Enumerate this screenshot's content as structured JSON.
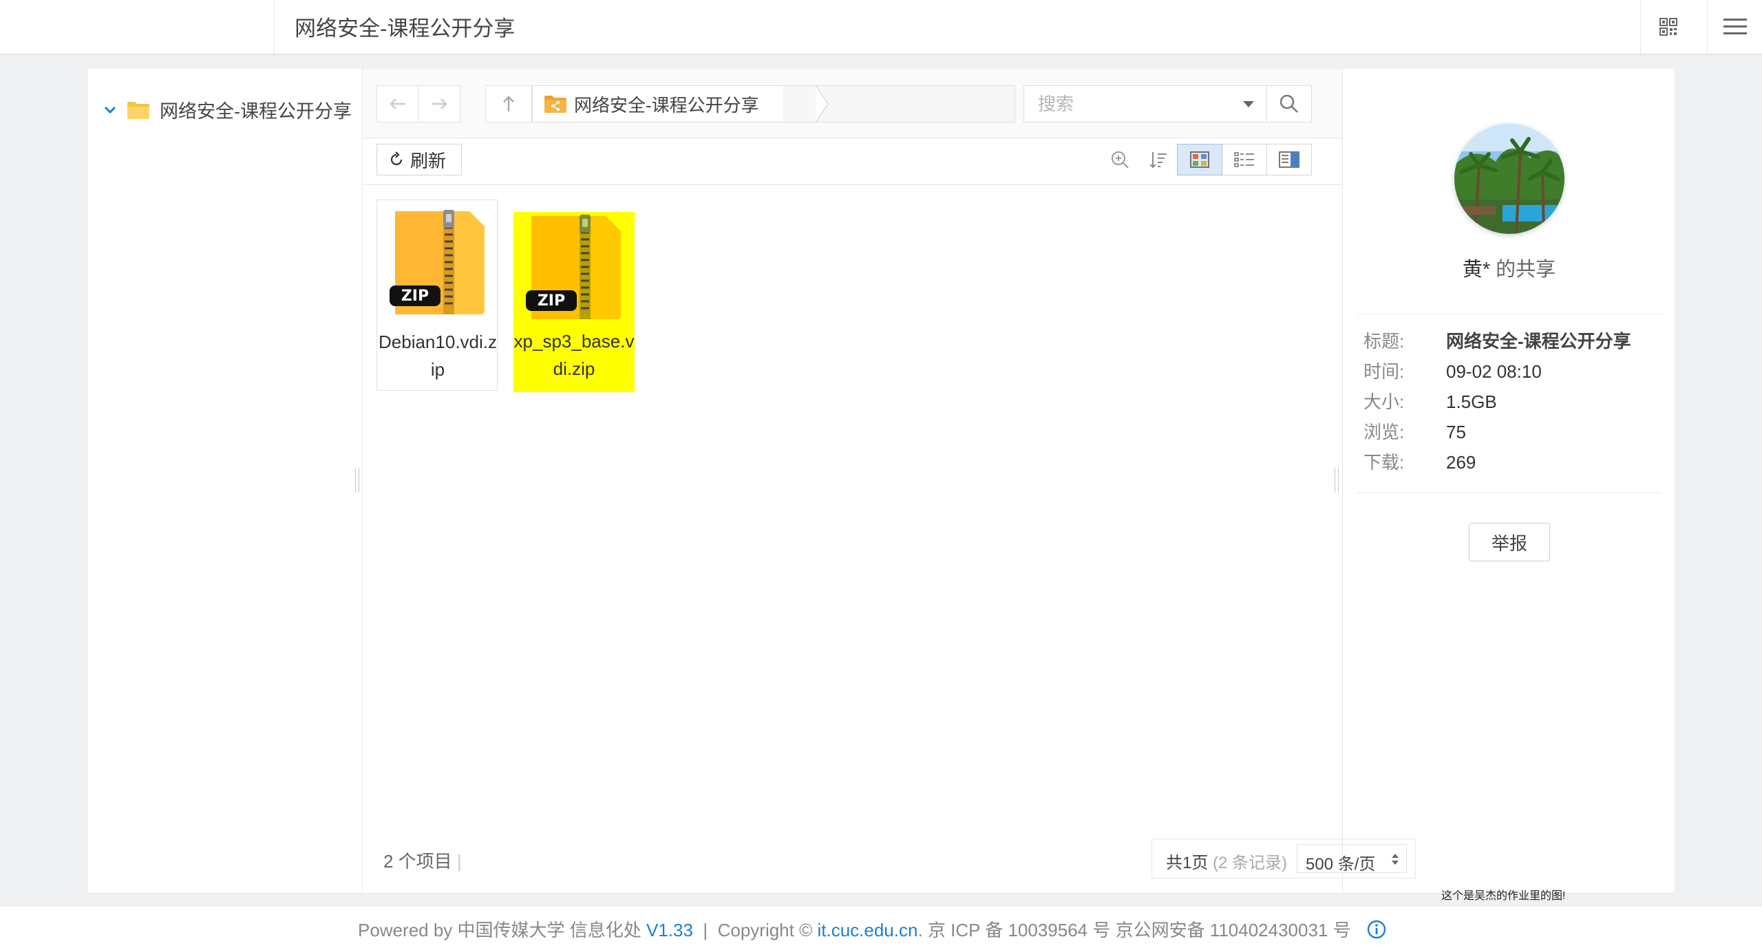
{
  "header": {
    "title": "网络安全-课程公开分享"
  },
  "tree": {
    "root_label": "网络安全-课程公开分享"
  },
  "breadcrumb": {
    "folder": "网络安全-课程公开分享"
  },
  "search": {
    "placeholder": "搜索"
  },
  "toolbar": {
    "refresh_label": "刷新"
  },
  "files": [
    {
      "name": "Debian10.vdi.zip",
      "badge": "ZIP",
      "selected": false
    },
    {
      "name": "xp_sp3_base.vdi.zip",
      "badge": "ZIP",
      "selected": true
    }
  ],
  "status": {
    "items_count": "2 个项目"
  },
  "pager": {
    "summary": "共1页",
    "records": "(2 条记录)",
    "page_size": "500 条/页"
  },
  "share": {
    "owner": "黄*",
    "owner_suffix": " 的共享",
    "fields": [
      {
        "label": "标题:",
        "value": "网络安全-课程公开分享"
      },
      {
        "label": "时间:",
        "value": "09-02 08:10"
      },
      {
        "label": "大小:",
        "value": "1.5GB"
      },
      {
        "label": "浏览:",
        "value": "75"
      },
      {
        "label": "下载:",
        "value": "269"
      }
    ],
    "report_label": "举报"
  },
  "note": "这个是吴杰的作业里的图!",
  "footer": {
    "powered": "Powered by 中国传媒大学 信息化处 ",
    "version": "V1.33",
    "sep": "  |  Copyright © ",
    "site": "it.cuc.edu.cn",
    "icp": ". 京 ICP 备 10039564 号 京公网安备 110402430031 号"
  },
  "colors": {
    "accent": "#1a7fd4",
    "selected_tile": "#ffff00",
    "folder": "#f5c242"
  }
}
